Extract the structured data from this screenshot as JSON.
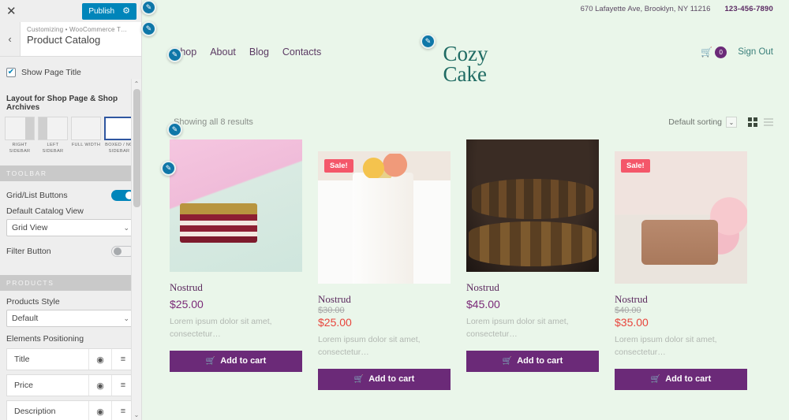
{
  "customizer": {
    "close_label": "✕",
    "publish_label": "Publish",
    "gear_icon": "⚙",
    "back_icon": "‹",
    "breadcrumb": "Customizing • WooCommerce T…",
    "section_title": "Product Catalog",
    "show_page_title": {
      "label": "Show Page Title",
      "checked": true,
      "check_glyph": "✔"
    },
    "layout_group_label": "Layout for Shop Page & Shop Archives",
    "layouts": [
      {
        "caption": "RIGHT SIDEBAR",
        "selected": false
      },
      {
        "caption": "LEFT SIDEBAR",
        "selected": false
      },
      {
        "caption": "FULL WIDTH",
        "selected": false
      },
      {
        "caption": "BOXED / NO SIDEBAR",
        "selected": true
      }
    ],
    "toolbar_band": "TOOLBAR",
    "grid_list_buttons": {
      "label": "Grid/List Buttons",
      "state": "on"
    },
    "default_catalog_view": {
      "label": "Default Catalog View",
      "value": "Grid View",
      "caret": "⌄"
    },
    "filter_button": {
      "label": "Filter Button",
      "state": "off"
    },
    "products_band": "PRODUCTS",
    "products_style": {
      "label": "Products Style",
      "value": "Default",
      "caret": "⌄"
    },
    "elements_positioning_label": "Elements Positioning",
    "elements": [
      {
        "name": "Title",
        "eye_icon": "◉",
        "drag_icon": "≡"
      },
      {
        "name": "Price",
        "eye_icon": "◉",
        "drag_icon": "≡"
      },
      {
        "name": "Description",
        "eye_icon": "◉",
        "drag_icon": "≡"
      }
    ],
    "scroll_up": "⌃",
    "scroll_down": "⌄"
  },
  "site": {
    "address": "670 Lafayette Ave, Brooklyn, NY 11216",
    "phone": "123-456-7890",
    "logo_line1": "Cozy",
    "logo_line2": "Cake",
    "nav": [
      {
        "label": "Shop"
      },
      {
        "label": "About"
      },
      {
        "label": "Blog"
      },
      {
        "label": "Contacts"
      }
    ],
    "cart": {
      "icon": "🛒",
      "count": "0"
    },
    "signout_label": "Sign Out"
  },
  "shop": {
    "results_text": "Showing all 8 results",
    "sorting_label": "Default sorting",
    "sorting_caret": "⌄",
    "view_grid_icon": "grid-view-icon",
    "view_list_icon": "list-view-icon",
    "cart_glyph": "🛒",
    "add_to_cart_label": "Add to cart",
    "sale_label": "Sale!",
    "description": "Lorem ipsum dolor sit amet, consectetur…",
    "products": [
      {
        "title": "Nostrud",
        "price": "$25.00",
        "old_price": "",
        "sale": false,
        "photo": "layer-cake-pink"
      },
      {
        "title": "Nostrud",
        "price": "$25.00",
        "old_price": "$30.00",
        "sale": true,
        "photo": "white-tiered-cake"
      },
      {
        "title": "Nostrud",
        "price": "$45.00",
        "old_price": "",
        "sale": false,
        "photo": "cupcake-stand"
      },
      {
        "title": "Nostrud",
        "price": "$35.00",
        "old_price": "$40.00",
        "sale": true,
        "photo": "chocolate-cake"
      }
    ]
  },
  "colors": {
    "wp_blue": "#0085ba",
    "purple": "#6b2a78",
    "sale_red": "#f4576a",
    "teal": "#1f6b63",
    "page_bg": "#eaf6ea"
  },
  "edit_pencil_icon": "✎"
}
